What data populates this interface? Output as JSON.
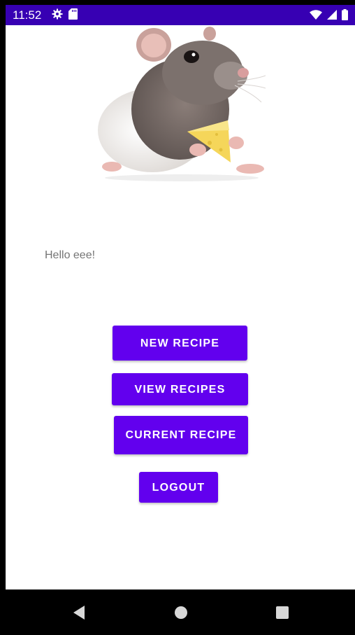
{
  "status_bar": {
    "time": "11:52",
    "background": "#3700b3",
    "left_icons": [
      "settings-gear-icon",
      "sd-card-icon"
    ],
    "right_icons": [
      "wifi-icon",
      "cell-signal-icon",
      "battery-icon"
    ]
  },
  "main": {
    "greeting": "Hello eee!",
    "image": "rat-holding-cheese-image"
  },
  "buttons": {
    "new_recipe": "NEW RECIPE",
    "view_recipes": "VIEW RECIPES",
    "current_recipe": "CURRENT RECIPE",
    "logout": "LOGOUT"
  },
  "nav_bar": {
    "back": "back-triangle-icon",
    "home": "home-circle-icon",
    "recents": "recents-square-icon"
  },
  "colors": {
    "accent": "#6200ee",
    "status_bar": "#3700b3",
    "background": "#ffffff",
    "greeting_text": "#757575"
  }
}
